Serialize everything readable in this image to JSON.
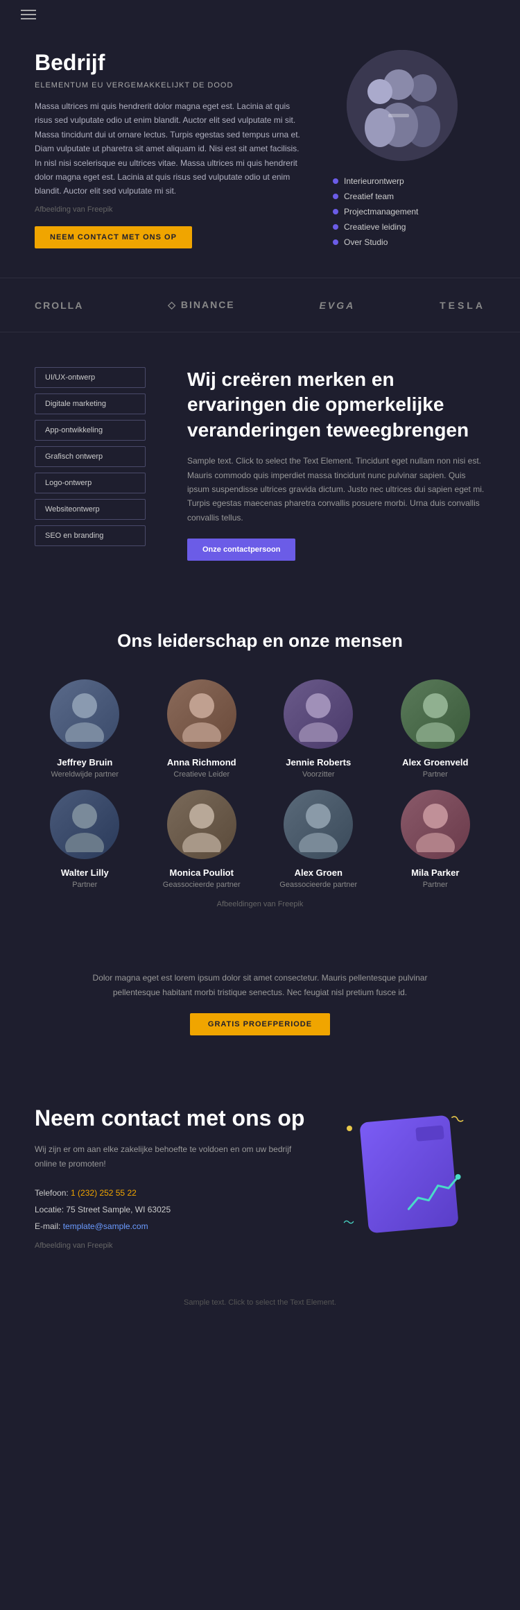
{
  "nav": {
    "hamburger_label": "Menu"
  },
  "hero": {
    "title": "Bedrijf",
    "subtitle": "ELEMENTUM EU VERGEMAKKELIJKT DE DOOD",
    "body": "Massa ultrices mi quis hendrerit dolor magna eget est. Lacinia at quis risus sed vulputate odio ut enim blandit. Auctor elit sed vulputate mi sit. Massa tincidunt dui ut ornare lectus. Turpis egestas sed tempus urna et. Diam vulputate ut pharetra sit amet aliquam id. Nisi est sit amet facilisis. In nisl nisi scelerisque eu ultrices vitae. Massa ultrices mi quis hendrerit dolor magna eget est. Lacinia at quis risus sed vulputate odio ut enim blandit. Auctor elit sed vulputate mi sit.",
    "image_credit": "Afbeelding van Freepik",
    "cta_label": "NEEM CONTACT MET ONS OP",
    "nav_items": [
      "Interieurontwerp",
      "Creatief team",
      "Projectmanagement",
      "Creatieve leiding",
      "Over Studio"
    ]
  },
  "brands": {
    "items": [
      {
        "name": "CROLLA"
      },
      {
        "name": "◇ BINANCE"
      },
      {
        "name": "EVGA"
      },
      {
        "name": "TESLA"
      }
    ]
  },
  "services": {
    "tags": [
      "UI/UX-ontwerp",
      "Digitale marketing",
      "App-ontwikkeling",
      "Grafisch ontwerp",
      "Logo-ontwerp",
      "Websiteontwerp",
      "SEO en branding"
    ],
    "heading": "Wij creëren merken en ervaringen die opmerkelijke veranderingen teweegbrengen",
    "body": "Sample text. Click to select the Text Element. Tincidunt eget nullam non nisi est. Mauris commodo quis imperdiet massa tincidunt nunc pulvinar sapien. Quis ipsum suspendisse ultrices gravida dictum. Justo nec ultrices dui sapien eget mi. Turpis egestas maecenas pharetra convallis posuere morbi. Urna duis convallis convallis tellus.",
    "cta_label": "Onze contactpersoon"
  },
  "team": {
    "heading": "Ons leiderschap en onze mensen",
    "members": [
      {
        "name": "Jeffrey Bruin",
        "role": "Wereldwijde partner",
        "emoji": "👨"
      },
      {
        "name": "Anna Richmond",
        "role": "Creatieve Leider",
        "emoji": "👩"
      },
      {
        "name": "Jennie Roberts",
        "role": "Voorzitter",
        "emoji": "👩"
      },
      {
        "name": "Alex Groenveld",
        "role": "Partner",
        "emoji": "👨"
      },
      {
        "name": "Walter Lilly",
        "role": "Partner",
        "emoji": "👨"
      },
      {
        "name": "Monica Pouliot",
        "role": "Geassocieerde partner",
        "emoji": "👩"
      },
      {
        "name": "Alex Groen",
        "role": "Geassocieerde partner",
        "emoji": "👨"
      },
      {
        "name": "Mila Parker",
        "role": "Partner",
        "emoji": "👩"
      }
    ],
    "credit": "Afbeeldingen van Freepik"
  },
  "cta": {
    "body": "Dolor magna eget est lorem ipsum dolor sit amet consectetur. Mauris pellentesque pulvinar pellentesque habitant morbi tristique senectus. Nec feugiat nisl pretium fusce id.",
    "button_label": "Gratis proefperiode"
  },
  "contact": {
    "heading": "Neem contact met ons op",
    "description": "Wij zijn er om aan elke zakelijke behoefte te voldoen en om uw bedrijf online te promoten!",
    "phone_label": "Telefoon:",
    "phone_value": "1 (232) 252 55 22",
    "location_label": "Locatie:",
    "location_value": "75 Street Sample, WI 63025",
    "email_label": "E-mail:",
    "email_value": "template@sample.com",
    "image_credit": "Afbeelding van Freepik"
  },
  "footer": {
    "note": "Sample text. Click to select the Text Element."
  }
}
